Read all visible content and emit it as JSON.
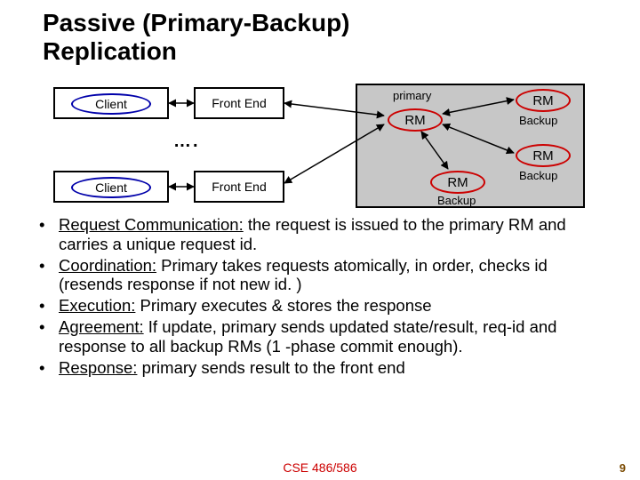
{
  "title_line1": "Passive (Primary-Backup)",
  "title_line2": "Replication",
  "diagram": {
    "client_label": "Client",
    "frontend_label": "Front End",
    "dots": "….",
    "primary_label": "primary",
    "rm_label": "RM",
    "backup_label": "Backup"
  },
  "bullets": {
    "b1_head": "Request Communication:",
    "b1_rest": " the request is issued to the primary RM and carries a unique request id.",
    "b2_head": "Coordination:",
    "b2_rest": " Primary takes requests atomically, in order, checks id (resends response if not new id. )",
    "b3_head": "Execution:",
    "b3_rest": " Primary executes & stores the response",
    "b4_head": "Agreement:",
    "b4_rest": " If update, primary sends updated state/result, req-id and response to all backup RMs (1 -phase commit enough).",
    "b5_head": "Response:",
    "b5_rest": " primary sends result to the front end"
  },
  "footer": "CSE 486/586",
  "page_number": "9"
}
